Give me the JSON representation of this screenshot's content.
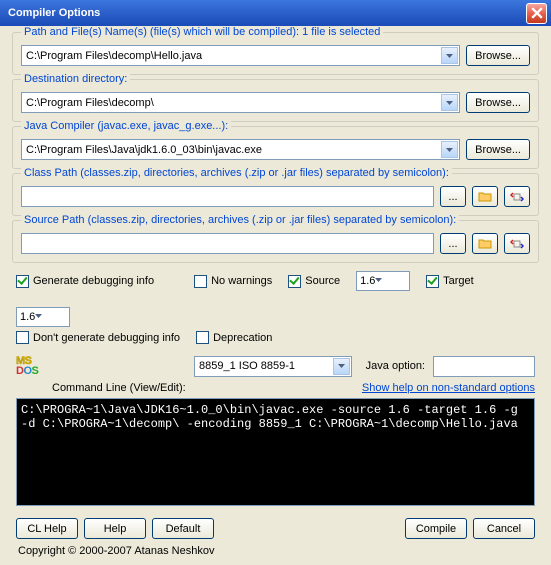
{
  "window": {
    "title": "Compiler Options"
  },
  "groups": {
    "path": {
      "label": "Path and File(s) Name(s) (file(s) which will be compiled):   1 file is selected",
      "value": "C:\\Program Files\\decomp\\Hello.java",
      "browse": "Browse..."
    },
    "dest": {
      "label": "Destination directory:",
      "value": "C:\\Program Files\\decomp\\",
      "browse": "Browse..."
    },
    "compiler": {
      "label": "Java Compiler (javac.exe,  javac_g.exe...):",
      "value": "C:\\Program Files\\Java\\jdk1.6.0_03\\bin\\javac.exe",
      "browse": "Browse..."
    },
    "classpath": {
      "label": "Class Path (classes.zip, directories, archives (.zip or .jar files) separated by semicolon):",
      "value": "",
      "dots": "..."
    },
    "sourcepath": {
      "label": "Source Path (classes.zip, directories, archives (.zip or .jar files) separated by semicolon):",
      "value": "",
      "dots": "..."
    }
  },
  "checks": {
    "gendbg": "Generate debugging info",
    "nowarn": "No warnings",
    "source": "Source",
    "source_val": "1.6",
    "target": "Target",
    "target_val": "1.6",
    "nodbg": "Don't generate debugging info",
    "depr": "Deprecation"
  },
  "mid": {
    "encoding": "8859_1 ISO 8859-1",
    "javaopt_label": "Java option:",
    "javaopt_val": "",
    "cmdlabel": "Command Line (View/Edit):",
    "helplink": "Show help on non-standard options"
  },
  "cmdline": "C:\\PROGRA~1\\Java\\JDK16~1.0_0\\bin\\javac.exe -source 1.6 -target 1.6 -g -d C:\\PROGRA~1\\decomp\\ -encoding 8859_1 C:\\PROGRA~1\\decomp\\Hello.java",
  "buttons": {
    "clhelp": "CL Help",
    "help": "Help",
    "default": "Default",
    "compile": "Compile",
    "cancel": "Cancel"
  },
  "copyright": "Copyright © 2000-2007 Atanas Neshkov"
}
